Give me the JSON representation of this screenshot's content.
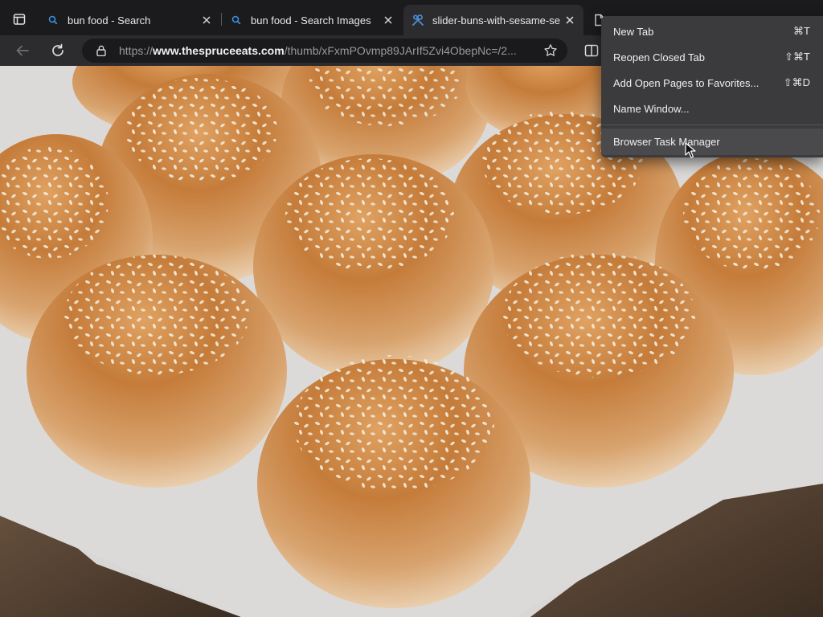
{
  "tabs": [
    {
      "title": "bun food - Search",
      "favicon": "search-icon",
      "active": false
    },
    {
      "title": "bun food - Search Images",
      "favicon": "search-icon",
      "active": false
    },
    {
      "title": "slider-buns-with-sesame-se",
      "favicon": "tools-icon",
      "active": true
    },
    {
      "title": "",
      "favicon": "page-icon",
      "active": false
    }
  ],
  "toolbar": {
    "url_prefix": "https://",
    "url_domain": "www.thespruceeats.com",
    "url_path": "/thumb/xFxmPOvmp89JArIf5Zvi4ObepNc=/2..."
  },
  "menu": {
    "items": [
      {
        "label": "New Tab",
        "shortcut": "⌘T"
      },
      {
        "label": "Reopen Closed Tab",
        "shortcut": "⇧⌘T"
      },
      {
        "label": "Add Open Pages to Favorites...",
        "shortcut": "⇧⌘D"
      },
      {
        "label": "Name Window...",
        "shortcut": ""
      }
    ],
    "highlighted": {
      "label": "Browser Task Manager",
      "shortcut": ""
    }
  },
  "colors": {
    "tabstrip_bg": "#1b1b1d",
    "toolbar_bg": "#2c2c2e",
    "menu_bg": "#3b3b3d",
    "search_favicon": "#3b8fe0",
    "bun_crust": "#c07a3a",
    "parchment": "#dcdad8"
  },
  "content": {
    "image_subject": "sesame seed slider buns on parchment paper"
  }
}
